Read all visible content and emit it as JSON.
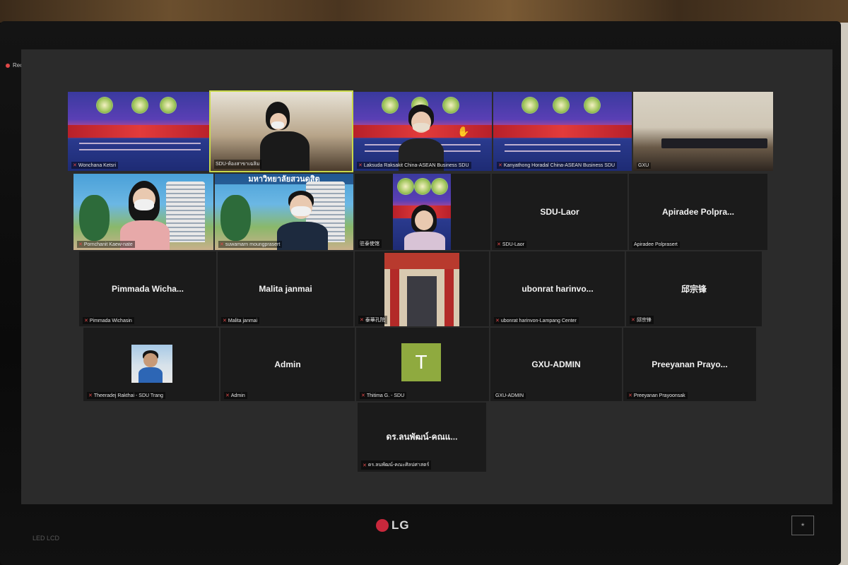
{
  "app": {
    "recording_label": "Recording..."
  },
  "monitor": {
    "brand": "LG",
    "model": "LED LCD"
  },
  "speaker_active": "SDU-ห้องสาขาเฉลิม",
  "tiles": {
    "wonchana": {
      "label": "Wonchana Ketsri"
    },
    "sdu_room": {
      "label": "SDU-ห้องสาขาเฉลิม"
    },
    "laksuda": {
      "label": "Laksuda Raksakit China-ASEAN Business SDU"
    },
    "kanyathong": {
      "label": "Kanyathong Horadal China-ASEAN Business SDU"
    },
    "gxu": {
      "label": "GXU"
    },
    "pornchanit": {
      "label": "Pornchanit Kaew-nate"
    },
    "suwamarn": {
      "label": "suwamarn moungprasert",
      "campus_text": "มหาวิทยาลัยสวนดุสิต"
    },
    "consulate": {
      "label": "驻泰使馆"
    },
    "sdu_laor": {
      "name": "SDU-Laor",
      "label": "SDU-Laor"
    },
    "apiradee": {
      "name": "Apiradee  Polpra...",
      "label": "Apiradee Polprasert"
    },
    "pimmada": {
      "name": "Pimmada  Wicha...",
      "label": "Pimmada Wichasin"
    },
    "malita": {
      "name": "Malita  janmai",
      "label": "Malita  janmai"
    },
    "confucius": {
      "label": "泰華孔院"
    },
    "ubonrat": {
      "name": "ubonrat  harinvo...",
      "label": "ubonrat harinvon-Lampang Center"
    },
    "qiu": {
      "name": "邱宗锋",
      "label": "邱宗锋"
    },
    "theeradej": {
      "label": "Theeradej Rakthai - SDU Trang"
    },
    "admin": {
      "name": "Admin",
      "label": "Admin"
    },
    "thitima": {
      "initial": "T",
      "label": "Thitima G. - SDU"
    },
    "gxu_admin": {
      "name": "GXU-ADMIN",
      "label": "GXU-ADMIN"
    },
    "preeyanan": {
      "name": "Preeyanan  Prayo...",
      "label": "Preeyanan Prayoonsak"
    },
    "dr_thai": {
      "name": "ดร.ลนพัฒน์-คณแ...",
      "label": "ดร.ลนพัฒน์-คณะศิลปศาสตร์"
    }
  },
  "colors": {
    "active_speaker_border": "#c9d94a",
    "mic_muted": "#e04848",
    "tile_bg": "#1b1b1b",
    "screen_bg": "#2b2b2b"
  },
  "icons": [
    "microphone-muted-icon",
    "raise-hand-icon",
    "recording-dot-icon"
  ]
}
